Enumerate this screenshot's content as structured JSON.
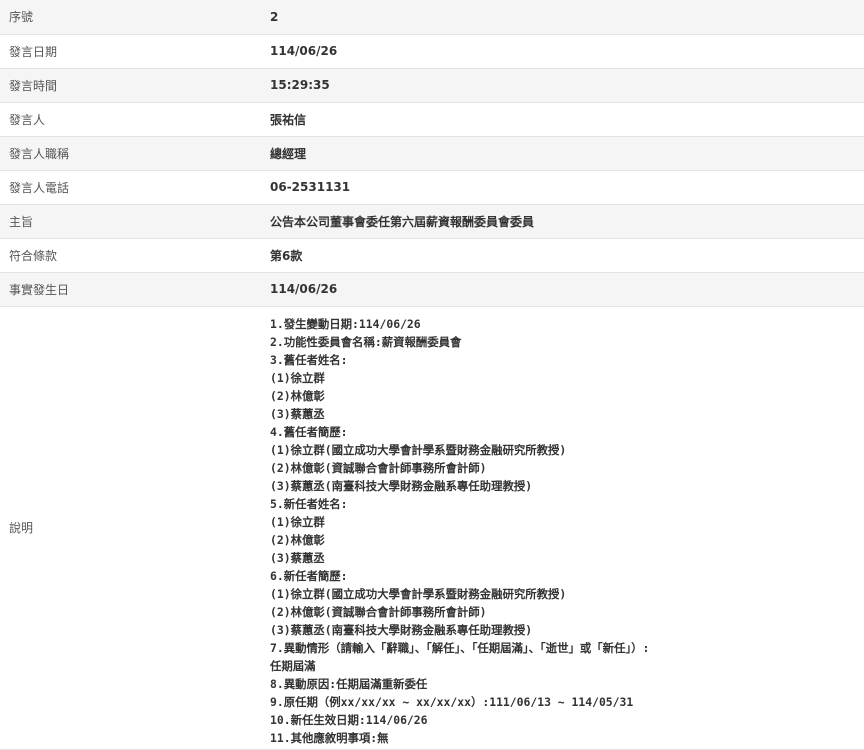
{
  "rows": [
    {
      "label": "序號",
      "value": "2"
    },
    {
      "label": "發言日期",
      "value": "114/06/26"
    },
    {
      "label": "發言時間",
      "value": "15:29:35"
    },
    {
      "label": "發言人",
      "value": "張祐信"
    },
    {
      "label": "發言人職稱",
      "value": "總經理"
    },
    {
      "label": "發言人電話",
      "value": "06-2531131"
    },
    {
      "label": "主旨",
      "value": "公告本公司董事會委任第六屆薪資報酬委員會委員"
    },
    {
      "label": "符合條款",
      "value": "第6款"
    },
    {
      "label": "事實發生日",
      "value": "114/06/26"
    }
  ],
  "description": {
    "label": "說明",
    "lines": [
      "1.發生變動日期:114/06/26",
      "2.功能性委員會名稱:薪資報酬委員會",
      "3.舊任者姓名:",
      "(1)徐立群",
      "(2)林億彰",
      "(3)蔡蕙丞",
      "4.舊任者簡歷:",
      "(1)徐立群(國立成功大學會計學系暨財務金融研究所教授)",
      "(2)林億彰(資誠聯合會計師事務所會計師)",
      "(3)蔡蕙丞(南臺科技大學財務金融系專任助理教授)",
      "5.新任者姓名:",
      "(1)徐立群",
      "(2)林億彰",
      "(3)蔡蕙丞",
      "6.新任者簡歷:",
      "(1)徐立群(國立成功大學會計學系暨財務金融研究所教授)",
      "(2)林億彰(資誠聯合會計師事務所會計師)",
      "(3)蔡蕙丞(南臺科技大學財務金融系專任助理教授)",
      "7.異動情形（請輸入「辭職」、「解任」、「任期屆滿」、「逝世」或「新任」）:",
      "任期屆滿",
      "8.異動原因:任期屆滿重新委任",
      "9.原任期（例xx/xx/xx ~ xx/xx/xx）:111/06/13 ~ 114/05/31",
      "10.新任生效日期:114/06/26",
      "11.其他應敘明事項:無"
    ]
  }
}
